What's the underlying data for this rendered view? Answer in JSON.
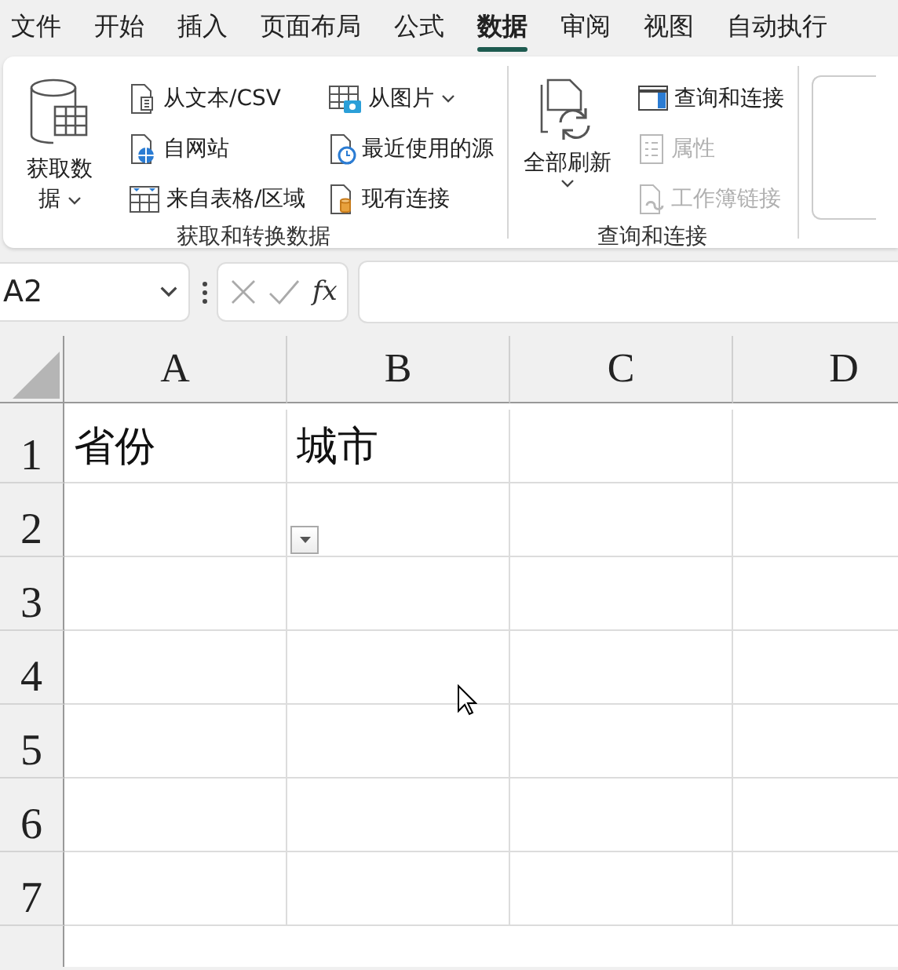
{
  "menu_tabs": [
    {
      "label": "文件",
      "selected": false
    },
    {
      "label": "开始",
      "selected": false
    },
    {
      "label": "插入",
      "selected": false
    },
    {
      "label": "页面布局",
      "selected": false
    },
    {
      "label": "公式",
      "selected": false
    },
    {
      "label": "数据",
      "selected": true
    },
    {
      "label": "审阅",
      "selected": false
    },
    {
      "label": "视图",
      "selected": false
    },
    {
      "label": "自动执行",
      "selected": false
    }
  ],
  "ribbon": {
    "groups": [
      {
        "label": "获取和转换数据",
        "large_button": {
          "label": "获取数据",
          "kind": "database",
          "dropdown": true
        },
        "columns": [
          [
            {
              "label": "从文本/CSV",
              "kind": "text-file",
              "dropdown": false,
              "disabled": false
            },
            {
              "label": "自网站",
              "kind": "web",
              "dropdown": false,
              "disabled": false
            },
            {
              "label": "来自表格/区域",
              "kind": "table",
              "dropdown": false,
              "disabled": false
            }
          ],
          [
            {
              "label": "从图片",
              "kind": "picture",
              "dropdown": true,
              "disabled": false
            },
            {
              "label": "最近使用的源",
              "kind": "recent",
              "dropdown": false,
              "disabled": false
            },
            {
              "label": "现有连接",
              "kind": "connection",
              "dropdown": false,
              "disabled": false
            }
          ]
        ]
      },
      {
        "label": "查询和连接",
        "large_button": {
          "label": "全部刷新",
          "kind": "refresh",
          "dropdown": true
        },
        "columns": [
          [
            {
              "label": "查询和连接",
              "kind": "panel",
              "dropdown": false,
              "disabled": false
            },
            {
              "label": "属性",
              "kind": "properties",
              "dropdown": false,
              "disabled": true
            },
            {
              "label": "工作簿链接",
              "kind": "link",
              "dropdown": false,
              "disabled": true
            }
          ]
        ]
      }
    ]
  },
  "formula_bar": {
    "name_box": "A2",
    "function_label": "fx"
  },
  "sheet": {
    "columns": [
      "A",
      "B",
      "C",
      "D"
    ],
    "rows": [
      {
        "header": "1",
        "cells": [
          {
            "text": "省份"
          },
          {
            "text": "城市"
          }
        ]
      },
      {
        "header": "2",
        "cells": [
          {},
          {
            "dropdown": true
          }
        ]
      },
      {
        "header": "3",
        "cells": []
      },
      {
        "header": "4",
        "cells": []
      },
      {
        "header": "5",
        "cells": []
      },
      {
        "header": "6",
        "cells": []
      },
      {
        "header": "7",
        "cells": []
      }
    ]
  }
}
